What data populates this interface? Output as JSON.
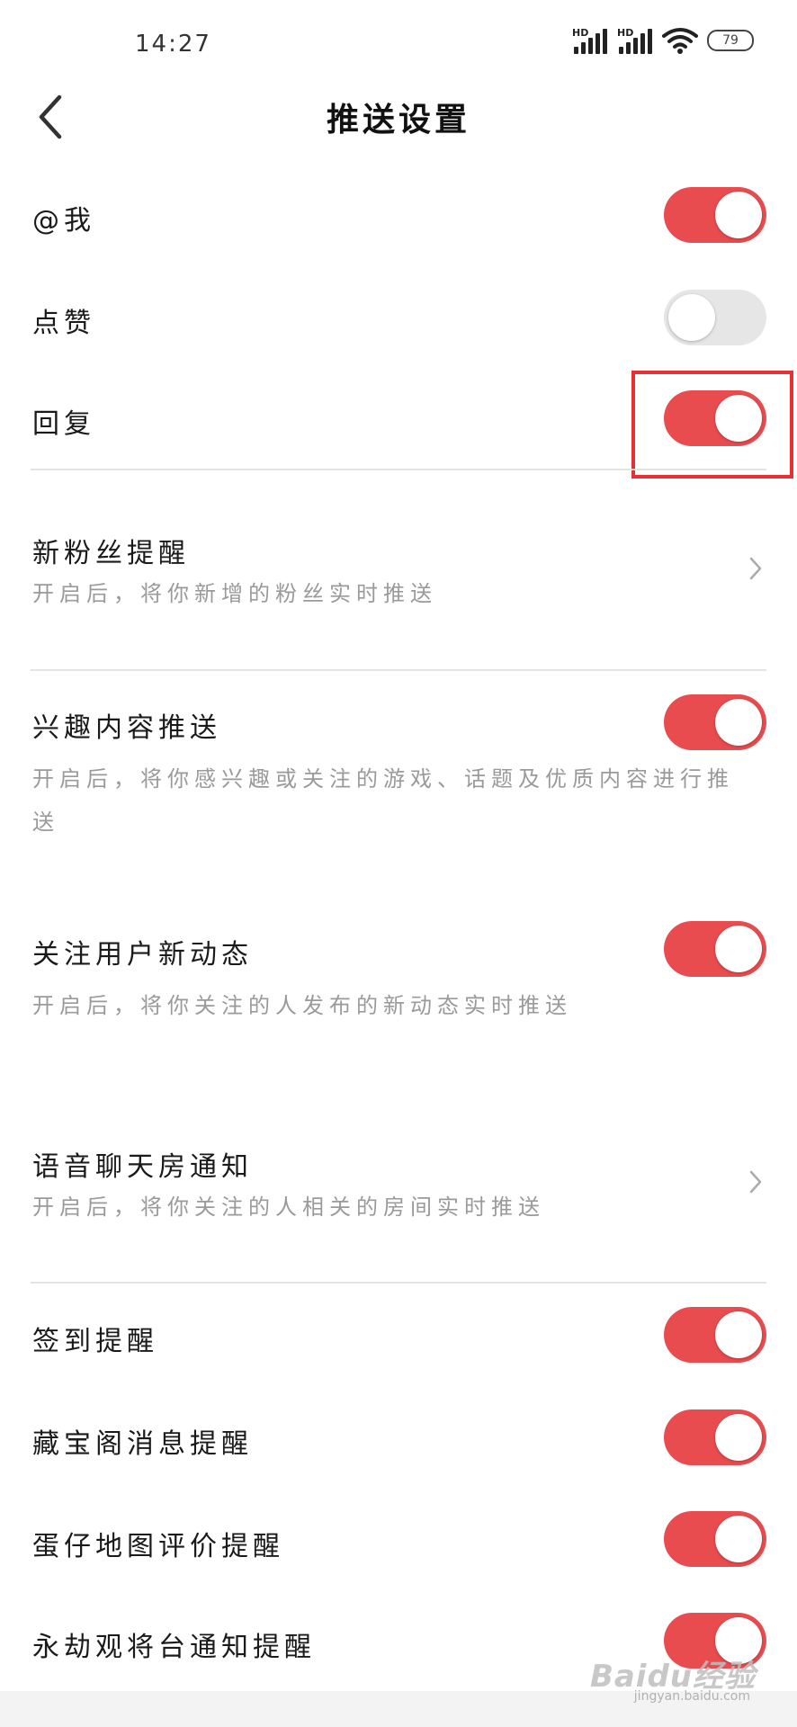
{
  "status_bar": {
    "time": "14:27",
    "signal_label_1": "HD",
    "signal_label_2": "HD",
    "battery": "79"
  },
  "header": {
    "title": "推送设置"
  },
  "settings": [
    {
      "label": "@我",
      "toggle": "on"
    },
    {
      "label": "点赞",
      "toggle": "off"
    },
    {
      "label": "回复",
      "toggle": "on"
    },
    {
      "label": "新粉丝提醒",
      "desc": "开启后，将你新增的粉丝实时推送",
      "control": "chevron"
    },
    {
      "label": "兴趣内容推送",
      "desc": "开启后，将你感兴趣或关注的游戏、话题及优质内容进行推送",
      "toggle": "on"
    },
    {
      "label": "关注用户新动态",
      "desc": "开启后，将你关注的人发布的新动态实时推送",
      "toggle": "on"
    },
    {
      "label": "语音聊天房通知",
      "desc": "开启后，将你关注的人相关的房间实时推送",
      "control": "chevron"
    },
    {
      "label": "签到提醒",
      "toggle": "on"
    },
    {
      "label": "藏宝阁消息提醒",
      "toggle": "on"
    },
    {
      "label": "蛋仔地图评价提醒",
      "toggle": "on"
    },
    {
      "label": "永劫观将台通知提醒",
      "toggle": "on"
    }
  ],
  "watermark": {
    "text": "Baidu经验",
    "sub": "jingyan.baidu.com"
  },
  "colors": {
    "toggle_on": "#e84c4f",
    "toggle_off": "#e6e6e6",
    "highlight_box": "#e53035"
  }
}
